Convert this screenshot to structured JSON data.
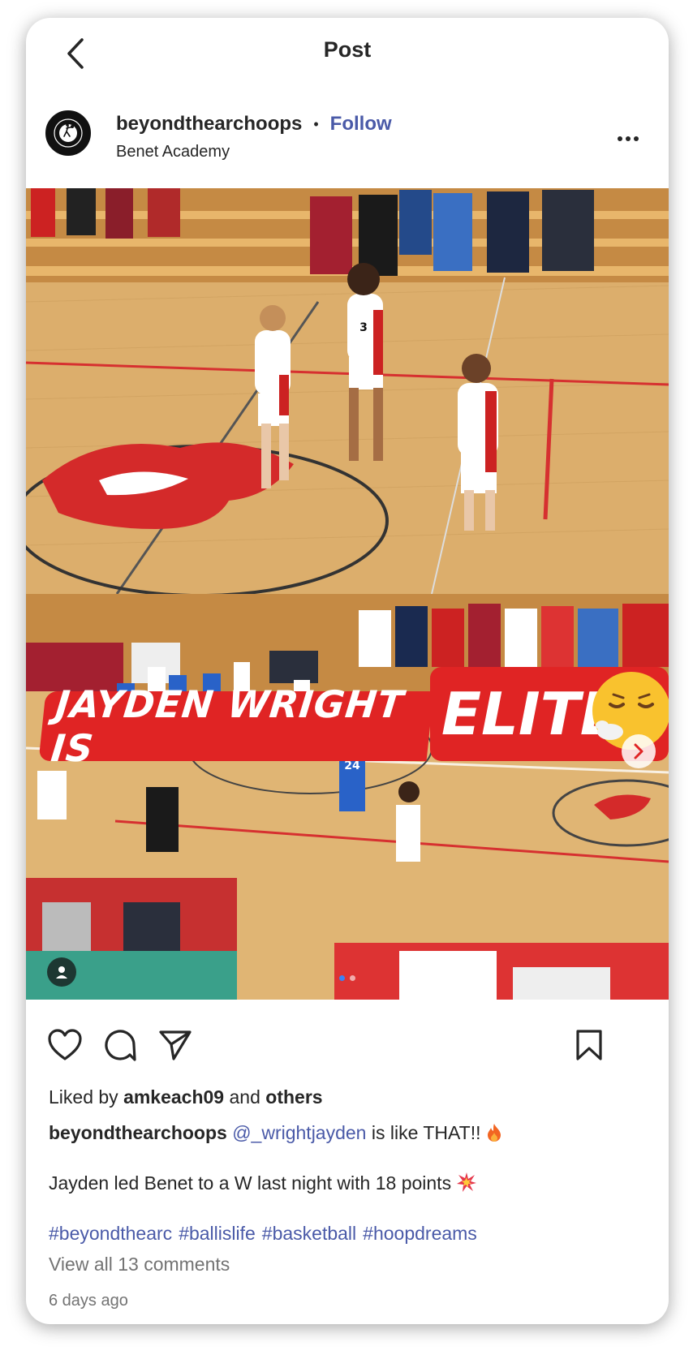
{
  "header": {
    "title": "Post",
    "back_icon": "chevron-left-icon"
  },
  "author": {
    "username": "beyondthearchoops",
    "separator": "•",
    "follow_label": "Follow",
    "location": "Benet Academy",
    "avatar_text": "BEYOND THE ARC HOOPS",
    "more_icon": "more-horizontal-icon"
  },
  "media": {
    "overlay_text_left": "JAYDEN WRIGHT IS",
    "overlay_text_right": "ELITE",
    "overlay_emoji": "face-exhaling-emoji",
    "jersey_numbers": [
      "3",
      "24"
    ],
    "next_icon": "chevron-right-icon",
    "tag_icon": "user-tag-icon",
    "slide_count": 2,
    "active_slide": 1
  },
  "actions": {
    "like_icon": "heart-icon",
    "comment_icon": "comment-icon",
    "share_icon": "send-icon",
    "save_icon": "bookmark-icon"
  },
  "likes": {
    "prefix": "Liked by",
    "user": "amkeach09",
    "middle": "and",
    "suffix": "others"
  },
  "caption": {
    "username": "beyondthearchoops",
    "mention": "@_wrightjayden",
    "text": "is like THAT!!",
    "emoji1": "fire-emoji",
    "line2": "Jayden led Benet to a W last night with 18 points",
    "emoji2": "collision-emoji",
    "hashtags": [
      "#beyondthearc",
      "#ballislife",
      "#basketball",
      "#hoopdreams"
    ]
  },
  "comments": {
    "view_all": "View all 13 comments"
  },
  "timestamp": "6 days ago",
  "colors": {
    "link_blue": "#4a5aa8",
    "banner_red": "#e02424",
    "court_wood": "#e0b574",
    "text_primary": "#262626",
    "text_secondary": "#737373"
  }
}
